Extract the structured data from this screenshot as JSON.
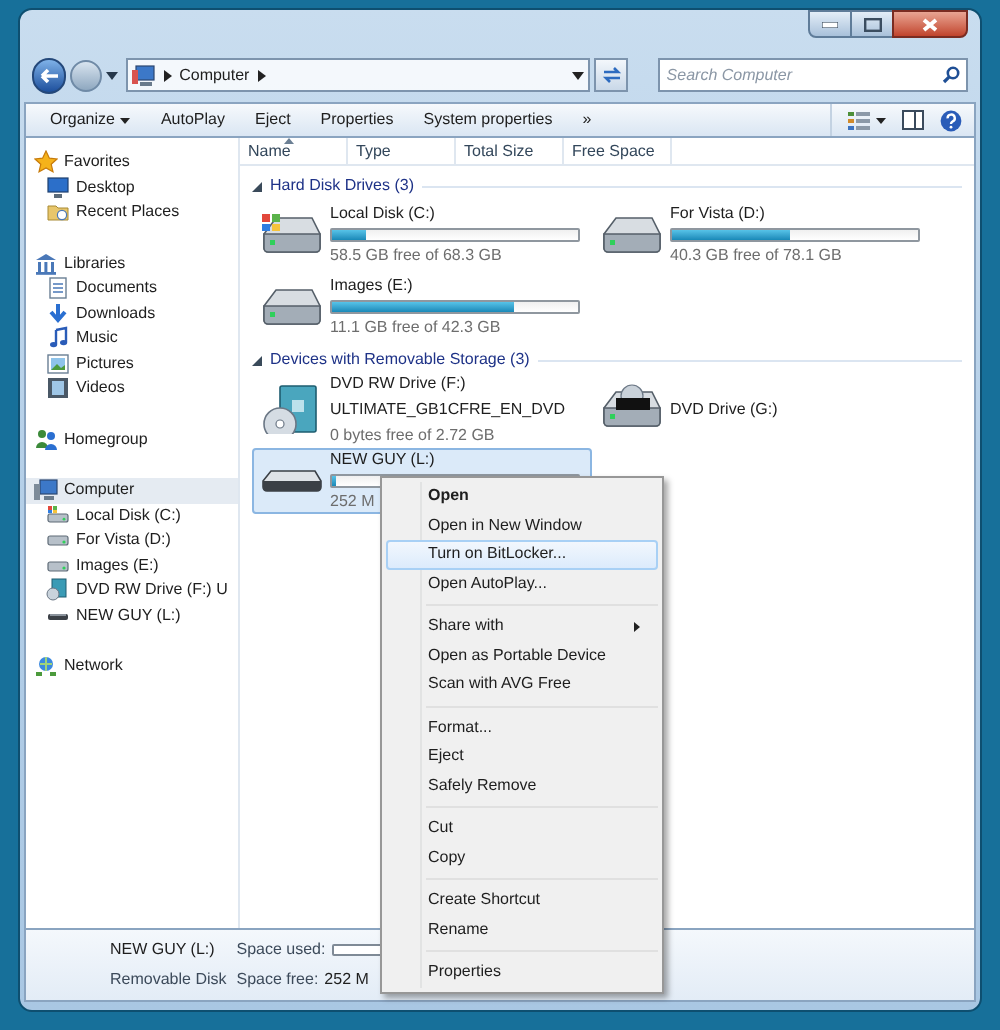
{
  "address_bar": {
    "path": [
      "Computer"
    ],
    "search_placeholder": "Search Computer"
  },
  "toolbar": {
    "buttons": [
      {
        "label": "Organize",
        "kind": "dropdown"
      },
      {
        "label": "AutoPlay",
        "kind": "plain"
      },
      {
        "label": "Eject",
        "kind": "plain"
      },
      {
        "label": "Properties",
        "kind": "plain"
      },
      {
        "label": "System properties",
        "kind": "plain"
      },
      {
        "label": "»",
        "kind": "plain"
      }
    ]
  },
  "navigation": [
    {
      "label": "Favorites",
      "kind": "favorites",
      "selected": false,
      "children": [
        {
          "label": "Desktop",
          "kind": "desktop",
          "selected": false
        },
        {
          "label": "Recent Places",
          "kind": "recent",
          "selected": false
        }
      ]
    },
    {
      "label": "Libraries",
      "kind": "libraries",
      "selected": false,
      "children": [
        {
          "label": "Documents",
          "kind": "documents",
          "selected": false
        },
        {
          "label": "Downloads",
          "kind": "downloads",
          "selected": false
        },
        {
          "label": "Music",
          "kind": "music",
          "selected": false
        },
        {
          "label": "Pictures",
          "kind": "pictures",
          "selected": false
        },
        {
          "label": "Videos",
          "kind": "videos",
          "selected": false
        }
      ]
    },
    {
      "label": "Homegroup",
      "kind": "homegroup",
      "selected": false
    },
    {
      "label": "Computer",
      "kind": "computer",
      "selected": true,
      "children": [
        {
          "label": "Local Disk (C:)",
          "kind": "system-disk",
          "selected": false
        },
        {
          "label": "For Vista (D:)",
          "kind": "disk",
          "selected": false
        },
        {
          "label": "Images (E:)",
          "kind": "disk",
          "selected": false
        },
        {
          "label": "DVD RW Drive (F:) U",
          "kind": "dvd-rw",
          "selected": false
        },
        {
          "label": "NEW GUY (L:)",
          "kind": "usb",
          "selected": false
        }
      ]
    },
    {
      "label": "Network",
      "kind": "network",
      "selected": false
    }
  ],
  "columns": [
    {
      "label": "Name",
      "sorted": true
    },
    {
      "label": "Type",
      "sorted": false
    },
    {
      "label": "Total Size",
      "sorted": false
    },
    {
      "label": "Free Space",
      "sorted": false
    }
  ],
  "sections": [
    {
      "title": "Hard Disk Drives (3)",
      "expanded": true,
      "drives": [
        {
          "name": "Local Disk (C:)",
          "kind": "system-disk",
          "level": 0.14,
          "free": "58.5 GB free of 68.3 GB",
          "selected": false
        },
        {
          "name": "For Vista (D:)",
          "kind": "disk",
          "level": 0.48,
          "free": "40.3 GB free of 78.1 GB",
          "selected": false
        },
        {
          "name": "Images (E:)",
          "kind": "disk",
          "level": 0.74,
          "free": "11.1 GB free of 42.3 GB",
          "selected": false
        }
      ]
    },
    {
      "title": "Devices with Removable Storage (3)",
      "expanded": true,
      "drives": [
        {
          "name": "DVD RW Drive (F:)",
          "label": "ULTIMATE_GB1CFRE_EN_DVD",
          "kind": "dvd-rw",
          "free": "0 bytes free of 2.72 GB",
          "selected": false
        },
        {
          "name": "DVD Drive (G:)",
          "kind": "dvd",
          "selected": false
        },
        {
          "name": "NEW GUY (L:)",
          "kind": "usb",
          "level": 0.02,
          "free": "252 M",
          "selected": true
        }
      ]
    }
  ],
  "details_pane": {
    "name": "NEW GUY (L:)",
    "type": "Removable Disk",
    "used_label": "Space used:",
    "free_label": "Space free:",
    "free": "252 M"
  },
  "context_menu": {
    "groups": [
      {
        "items": [
          {
            "label": "Open",
            "kind": "default",
            "selected": false
          },
          {
            "label": "Open in New Window",
            "kind": "normal",
            "selected": false
          },
          {
            "label": "Turn on BitLocker...",
            "kind": "normal",
            "selected": true
          },
          {
            "label": "Open AutoPlay...",
            "kind": "normal",
            "selected": false
          }
        ]
      },
      {
        "items": [
          {
            "label": "Share with",
            "kind": "submenu",
            "selected": false
          },
          {
            "label": "Open as Portable Device",
            "kind": "normal",
            "selected": false
          },
          {
            "label": "Scan with AVG Free",
            "kind": "normal",
            "selected": false
          }
        ]
      },
      {
        "items": [
          {
            "label": "Format...",
            "kind": "normal",
            "selected": false
          },
          {
            "label": "Eject",
            "kind": "normal",
            "selected": false
          },
          {
            "label": "Safely Remove",
            "kind": "normal",
            "selected": false
          }
        ]
      },
      {
        "items": [
          {
            "label": "Cut",
            "kind": "normal",
            "selected": false
          },
          {
            "label": "Copy",
            "kind": "normal",
            "selected": false
          }
        ]
      },
      {
        "items": [
          {
            "label": "Create Shortcut",
            "kind": "normal",
            "selected": false
          },
          {
            "label": "Rename",
            "kind": "normal",
            "selected": false
          }
        ]
      },
      {
        "items": [
          {
            "label": "Properties",
            "kind": "normal",
            "selected": false
          }
        ]
      }
    ]
  }
}
